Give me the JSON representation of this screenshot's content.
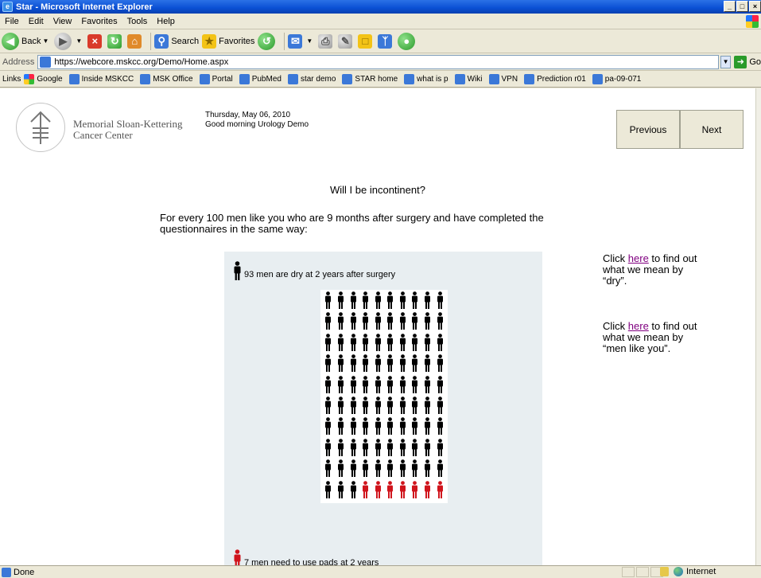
{
  "window": {
    "title": "Star - Microsoft Internet Explorer",
    "controls": [
      "_",
      "□",
      "×"
    ]
  },
  "menu": [
    "File",
    "Edit",
    "View",
    "Favorites",
    "Tools",
    "Help"
  ],
  "toolbar": {
    "back": "Back",
    "search": "Search",
    "favorites": "Favorites"
  },
  "address": {
    "label": "Address",
    "url": "https://webcore.mskcc.org/Demo/Home.aspx",
    "go": "Go"
  },
  "links": {
    "label": "Links",
    "items": [
      "Google",
      "Inside MSKCC",
      "MSK Office",
      "Portal",
      "PubMed",
      "star demo",
      "STAR home",
      "what is p",
      "Wiki",
      "VPN",
      "Prediction r01",
      "pa-09-071"
    ]
  },
  "header": {
    "org_line1": "Memorial Sloan-Kettering",
    "org_line2": "Cancer Center",
    "date": "Thursday, May 06, 2010",
    "greeting": "Good morning Urology Demo",
    "prev_label": "Previous",
    "next_label": "Next"
  },
  "main": {
    "question": "Will I be incontinent?",
    "description": "For every 100 men like you who are 9 months after surgery and have completed the questionnaires in the same way:",
    "dry_legend": "93 men are dry at 2 years after surgery",
    "pads_legend": "7 men need to use pads at 2 years",
    "colors": {
      "dry": "#000000",
      "pads": "#d0141c"
    },
    "figure": {
      "total": 100,
      "dry": 93,
      "pads": 7,
      "columns": 10
    },
    "side_notes": [
      {
        "prefix": "Click ",
        "link": "here",
        "suffix": " to find out what we mean by “dry”."
      },
      {
        "prefix": "Click ",
        "link": "here",
        "suffix": " to find out what we mean by “men like you”."
      }
    ]
  },
  "status": {
    "text": "Done",
    "zone": "Internet"
  }
}
